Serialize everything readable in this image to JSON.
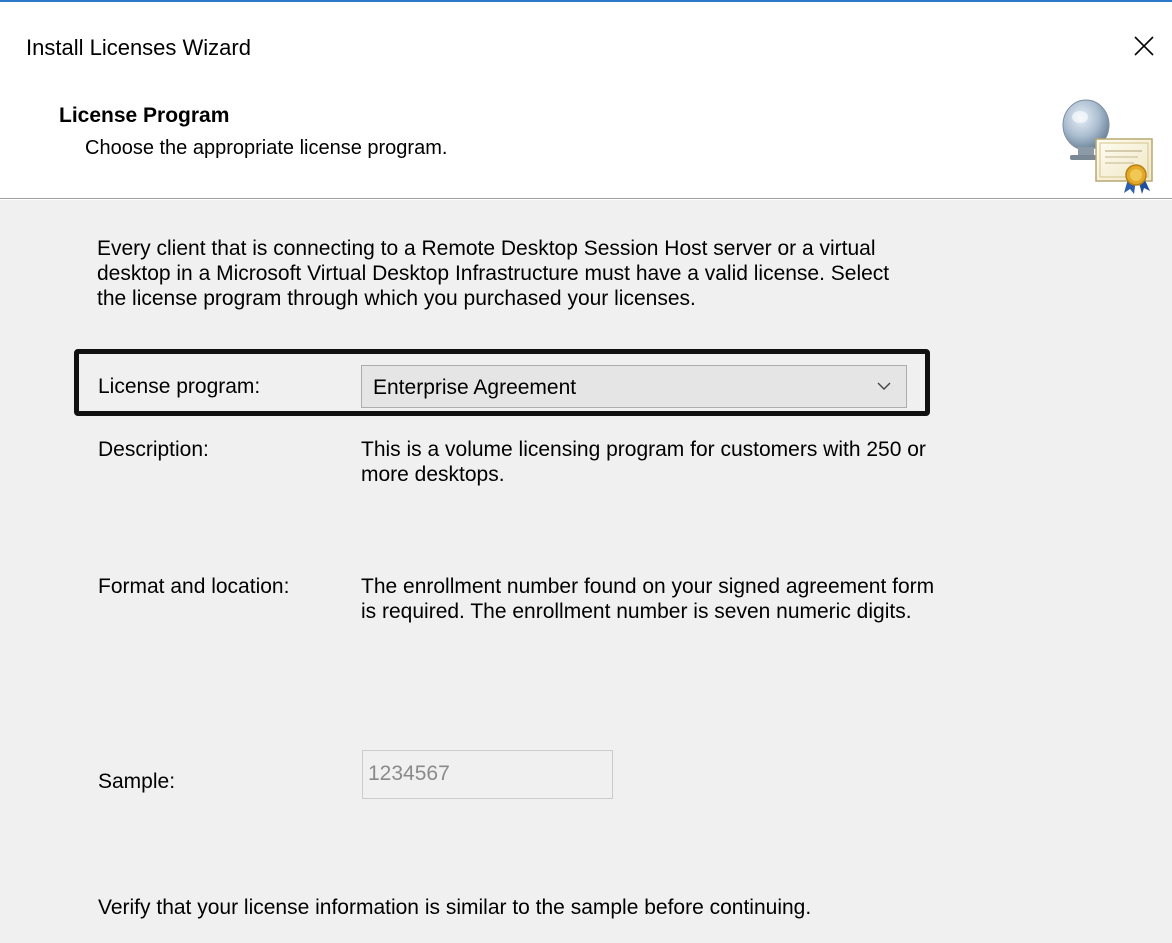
{
  "window": {
    "title": "Install Licenses Wizard"
  },
  "header": {
    "title": "License Program",
    "subtitle": "Choose the appropriate license program.",
    "icon": "license-certificate-icon"
  },
  "content": {
    "intro_line1": "Every client that is connecting to a Remote Desktop Session Host server or a virtual",
    "intro_line2": "desktop in a Microsoft Virtual Desktop Infrastructure must have a valid license. Select",
    "intro_line3": "the license program through which you purchased your licenses.",
    "license_program_label": "License program:",
    "license_program_value": "Enterprise Agreement",
    "description_label": "Description:",
    "description_line1": "This is a volume licensing program for customers with 250 or",
    "description_line2": "more desktops.",
    "format_label": "Format and location:",
    "format_line1": "The enrollment number found on your signed agreement form",
    "format_line2": "is required. The enrollment number is seven numeric digits.",
    "sample_label": "Sample:",
    "sample_value": "1234567",
    "verify_text": "Verify that your license information is similar to the sample before continuing."
  },
  "colors": {
    "accent": "#2b78c8",
    "background": "#f0f0f0",
    "header_background": "#ffffff",
    "highlight_border": "#111111"
  }
}
